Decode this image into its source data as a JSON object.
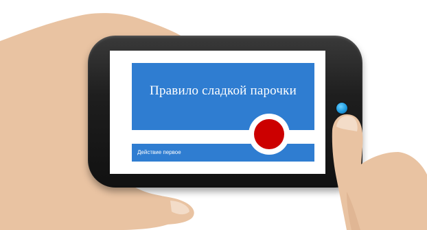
{
  "slide": {
    "title": "Правило сладкой парочки",
    "subtitle": "Действие первое"
  },
  "colors": {
    "slide_blue": "#2f7dd1",
    "dot_red": "#cc0000",
    "home_button": "#1f9be0",
    "phone_body": "#1e1e1e"
  },
  "icons": {
    "home_button": "home-button-icon",
    "dot": "red-circle-icon"
  }
}
